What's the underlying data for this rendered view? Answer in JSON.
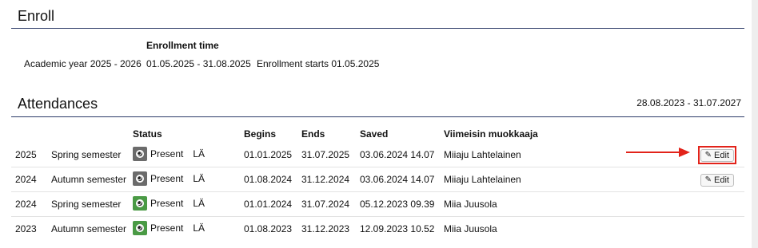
{
  "enroll": {
    "title": "Enroll",
    "column_header": "Enrollment time",
    "academic_year": "Academic year 2025 - 2026",
    "period": "01.05.2025 - 31.08.2025",
    "starts": "Enrollment starts 01.05.2025"
  },
  "attendances": {
    "title": "Attendances",
    "range": "28.08.2023 - 31.07.2027",
    "headers": {
      "status": "Status",
      "begins": "Begins",
      "ends": "Ends",
      "saved": "Saved",
      "modifier": "Viimeisin muokkaaja"
    },
    "rows": [
      {
        "year": "2025",
        "semester": "Spring semester",
        "status": "Present",
        "code": "LÄ",
        "begins": "01.01.2025",
        "ends": "31.07.2025",
        "saved": "03.06.2024 14.07",
        "modifier": "Miiaju Lahtelainen",
        "edit": "Edit",
        "status_color": "#6b6b6b"
      },
      {
        "year": "2024",
        "semester": "Autumn semester",
        "status": "Present",
        "code": "LÄ",
        "begins": "01.08.2024",
        "ends": "31.12.2024",
        "saved": "03.06.2024 14.07",
        "modifier": "Miiaju Lahtelainen",
        "edit": "Edit",
        "status_color": "#6b6b6b"
      },
      {
        "year": "2024",
        "semester": "Spring semester",
        "status": "Present",
        "code": "LÄ",
        "begins": "01.01.2024",
        "ends": "31.07.2024",
        "saved": "05.12.2023 09.39",
        "modifier": "Miia Juusola",
        "status_color": "#4a9a45"
      },
      {
        "year": "2023",
        "semester": "Autumn semester",
        "status": "Present",
        "code": "LÄ",
        "begins": "01.08.2023",
        "ends": "31.12.2023",
        "saved": "12.09.2023 10.52",
        "modifier": "Miia Juusola",
        "status_color": "#4a9a45"
      }
    ]
  },
  "colors": {
    "rule": "#2b3a67",
    "annotation": "#e2231a"
  }
}
